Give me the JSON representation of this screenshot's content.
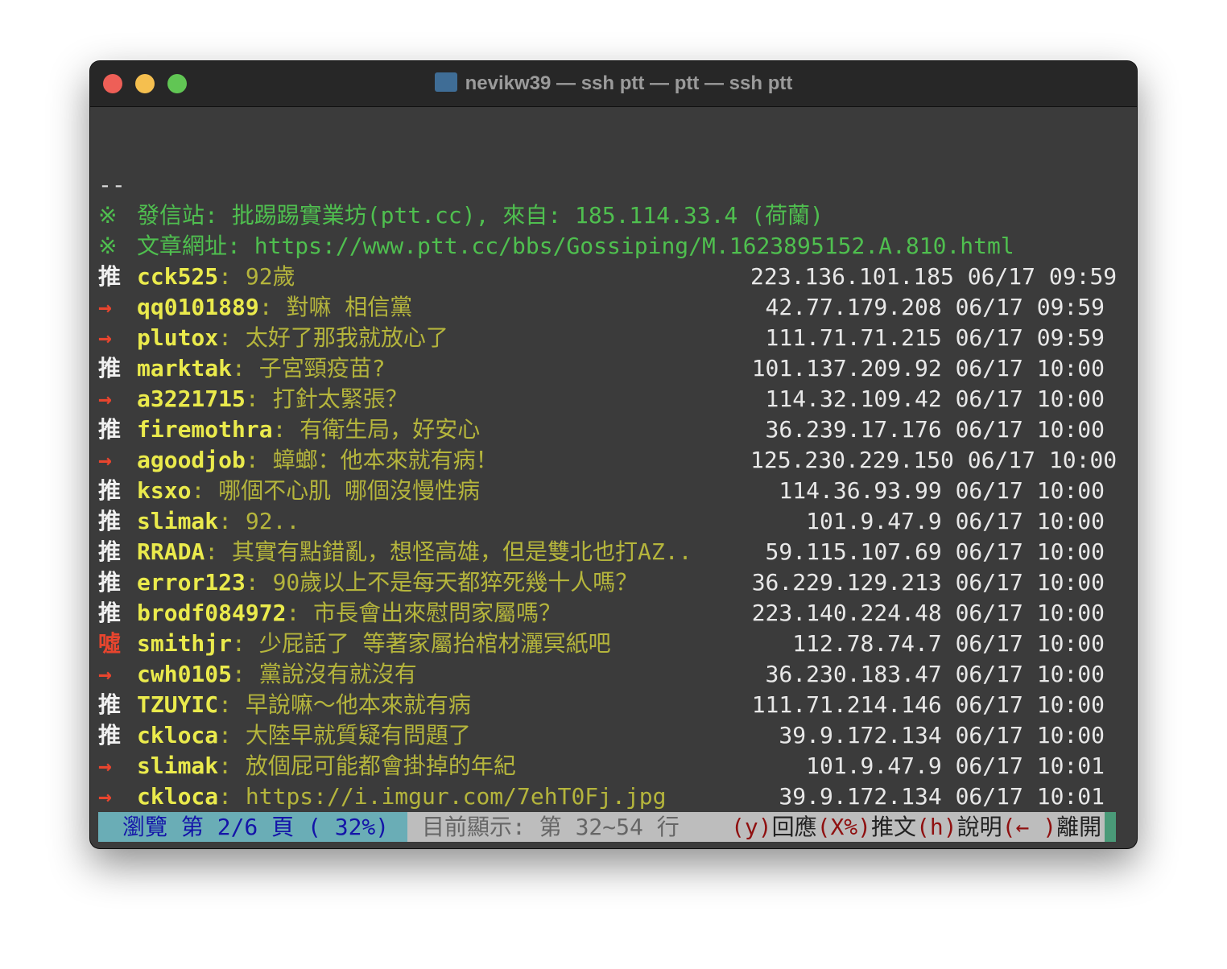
{
  "window": {
    "title": "nevikw39 — ssh ptt — ptt — ssh ptt",
    "colors": {
      "close": "#ee5f57",
      "minimize": "#f5bf4f",
      "maximize": "#61c654"
    }
  },
  "separator": "--",
  "info": [
    {
      "mark": "※",
      "text": "發信站: 批踢踢實業坊(ptt.cc), 來自: 185.114.33.4 (荷蘭)"
    },
    {
      "mark": "※",
      "text": "文章網址: https://www.ptt.cc/bbs/Gossiping/M.1623895152.A.810.html"
    }
  ],
  "comments": [
    {
      "tag": "推",
      "user": "cck525",
      "msg": "92歲",
      "ip": "223.136.101.185",
      "time": "06/17 09:59"
    },
    {
      "tag": "→",
      "user": "qq0101889",
      "msg": "對嘛 相信黨",
      "ip": "42.77.179.208",
      "time": "06/17 09:59"
    },
    {
      "tag": "→",
      "user": "plutox",
      "msg": "太好了那我就放心了",
      "ip": "111.71.71.215",
      "time": "06/17 09:59"
    },
    {
      "tag": "推",
      "user": "marktak",
      "msg": "子宮頸疫苗?",
      "ip": "101.137.209.92",
      "time": "06/17 10:00"
    },
    {
      "tag": "→",
      "user": "a3221715",
      "msg": "打針太緊張？",
      "ip": "114.32.109.42",
      "time": "06/17 10:00"
    },
    {
      "tag": "推",
      "user": "firemothra",
      "msg": "有衛生局，好安心",
      "ip": "36.239.17.176",
      "time": "06/17 10:00"
    },
    {
      "tag": "→",
      "user": "agoodjob",
      "msg": "蟑螂：他本來就有病！",
      "ip": "125.230.229.150",
      "time": "06/17 10:00"
    },
    {
      "tag": "推",
      "user": "ksxo",
      "msg": "哪個不心肌 哪個沒慢性病",
      "ip": "114.36.93.99",
      "time": "06/17 10:00"
    },
    {
      "tag": "推",
      "user": "slimak",
      "msg": "92..",
      "ip": "101.9.47.9",
      "time": "06/17 10:00"
    },
    {
      "tag": "推",
      "user": "RRADA",
      "msg": "其實有點錯亂，想怪高雄，但是雙北也打AZ..",
      "ip": "59.115.107.69",
      "time": "06/17 10:00"
    },
    {
      "tag": "推",
      "user": "error123",
      "msg": "90歲以上不是每天都猝死幾十人嗎？",
      "ip": "36.229.129.213",
      "time": "06/17 10:00"
    },
    {
      "tag": "推",
      "user": "brodf084972",
      "msg": "市長會出來慰問家屬嗎？",
      "ip": "223.140.224.48",
      "time": "06/17 10:00"
    },
    {
      "tag": "噓",
      "user": "smithjr",
      "msg": "少屁話了 等著家屬抬棺材灑冥紙吧",
      "ip": "112.78.74.7",
      "time": "06/17 10:00"
    },
    {
      "tag": "→",
      "user": "cwh0105",
      "msg": "黨說沒有就沒有",
      "ip": "36.230.183.47",
      "time": "06/17 10:00"
    },
    {
      "tag": "推",
      "user": "TZUYIC",
      "msg": "早說嘛～他本來就有病",
      "ip": "111.71.214.146",
      "time": "06/17 10:00"
    },
    {
      "tag": "推",
      "user": "ckloca",
      "msg": "大陸早就質疑有問題了",
      "ip": "39.9.172.134",
      "time": "06/17 10:00"
    },
    {
      "tag": "→",
      "user": "slimak",
      "msg": "放個屁可能都會掛掉的年紀",
      "ip": "101.9.47.9",
      "time": "06/17 10:01"
    },
    {
      "tag": "→",
      "user": "ckloca",
      "msg": "https://i.imgur.com/7ehT0Fj.jpg",
      "ip": "39.9.172.134",
      "time": "06/17 10:01"
    }
  ],
  "status": {
    "browse": "瀏覽 第 2/6 頁 ( 32%)",
    "showing": "目前顯示: 第 32~54 行",
    "keys": [
      {
        "key": "(y)",
        "label": "回應"
      },
      {
        "key": "(X%)",
        "label": "推文"
      },
      {
        "key": "(h)",
        "label": "說明"
      },
      {
        "key": "(← )",
        "label": "離開"
      }
    ]
  }
}
